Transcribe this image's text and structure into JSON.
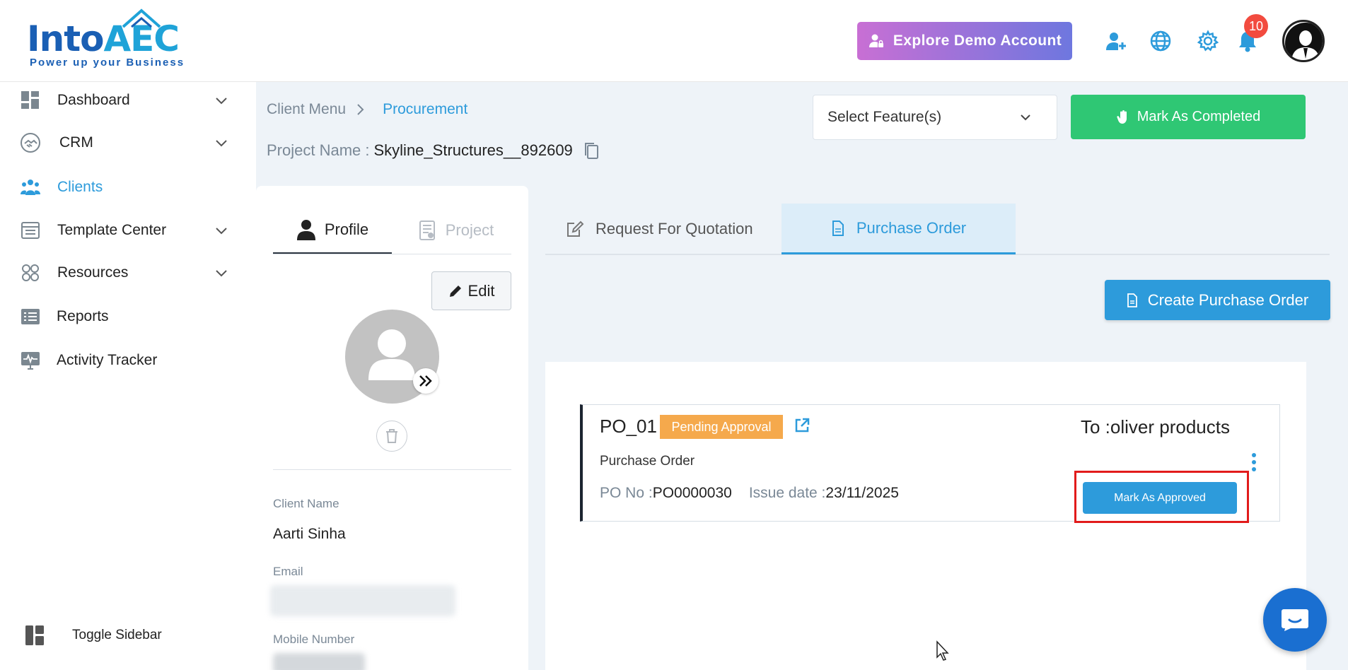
{
  "brand": {
    "logo_text_1": "Into",
    "logo_text_2": "AEC",
    "tagline": "Power up your Business"
  },
  "header": {
    "demo_button_label": "Explore Demo Account",
    "notification_count": "10",
    "icons": [
      "add-user-icon",
      "globe-icon",
      "gear-icon",
      "bell-icon"
    ]
  },
  "sidebar": {
    "items": [
      {
        "label": "Dashboard",
        "icon": "dashboard-icon",
        "expandable": true
      },
      {
        "label": "CRM",
        "icon": "handshake-icon",
        "expandable": true
      },
      {
        "label": "Clients",
        "icon": "users-group-icon",
        "expandable": false,
        "active": true
      },
      {
        "label": "Template Center",
        "icon": "template-icon",
        "expandable": true
      },
      {
        "label": "Resources",
        "icon": "resources-icon",
        "expandable": true
      },
      {
        "label": "Reports",
        "icon": "list-icon",
        "expandable": false
      },
      {
        "label": "Activity Tracker",
        "icon": "monitor-pulse-icon",
        "expandable": false
      }
    ],
    "toggle_label": "Toggle Sidebar"
  },
  "breadcrumb": {
    "parent": "Client Menu",
    "current": "Procurement"
  },
  "project": {
    "label": "Project Name :",
    "value": "Skyline_Structures__892609"
  },
  "feature_select": {
    "placeholder": "Select Feature(s)"
  },
  "mark_completed_label": "Mark As Completed",
  "profile": {
    "tabs": [
      "Profile",
      "Project"
    ],
    "edit_label": "Edit",
    "client_name_label": "Client Name",
    "client_name_value": "Aarti Sinha",
    "email_label": "Email",
    "mobile_label": "Mobile Number"
  },
  "procurement": {
    "tabs": [
      "Request For Quotation",
      "Purchase Order"
    ],
    "active_tab": "Purchase Order",
    "create_button_label": "Create Purchase Order",
    "po_card": {
      "id": "PO_01",
      "status": "Pending Approval",
      "to": "To :oliver products",
      "type": "Purchase Order",
      "po_no_label": "PO No :",
      "po_no_value": "PO0000030",
      "issue_date_label": "Issue date :",
      "issue_date_value": "23/11/2025",
      "approve_button_label": "Mark As Approved"
    }
  },
  "colors": {
    "accent": "#2d9bdb",
    "success": "#2fc774",
    "pending": "#f5a94c",
    "danger": "#e21b1b"
  }
}
